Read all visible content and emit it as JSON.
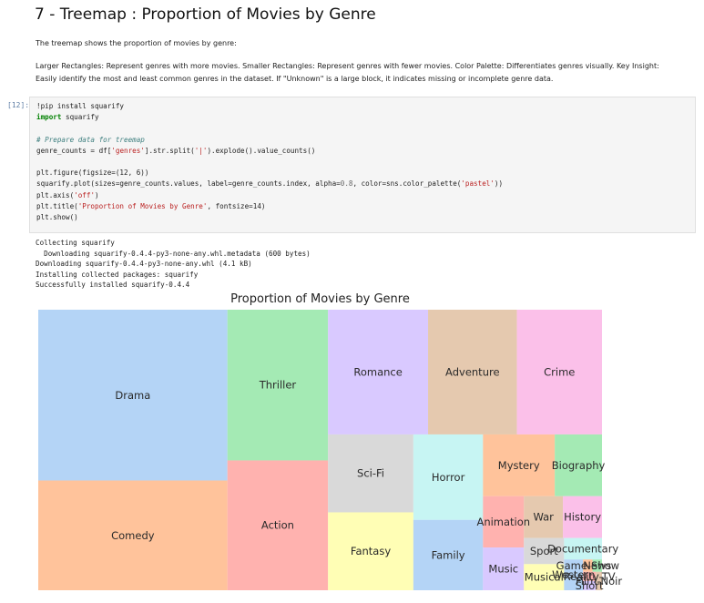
{
  "notebook": {
    "title": "7 - Treemap : Proportion of Movies by Genre",
    "intro": "The treemap shows the proportion of movies by genre:",
    "description_line1": "Larger Rectangles: Represent genres with more movies. Smaller Rectangles: Represent genres with fewer movies. Color Palette: Differentiates genres visually. Key Insight:",
    "description_line2": "Easily identify the most and least common genres in the dataset. If \"Unknown\" is a large block, it indicates missing or incomplete genre data.",
    "cell_prompt": "[12]:",
    "code": {
      "l1": "!pip install squarify",
      "l2_kw": "import",
      "l2_rest": " squarify",
      "l3_comment": "# Prepare data for treemap",
      "l4_a": "genre_counts = df[",
      "l4_str1": "'genres'",
      "l4_b": "].str.split(",
      "l4_str2": "'|'",
      "l4_c": ").explode().value_counts()",
      "l5": "plt.figure(figsize=(12, 6))",
      "l6_a": "squarify.plot(sizes=genre_counts.values, label=genre_counts.index, alpha=",
      "l6_num": "0.8",
      "l6_b": ", color=sns.color_palette(",
      "l6_str": "'pastel'",
      "l6_c": "))",
      "l7_a": "plt.axis(",
      "l7_str": "'off'",
      "l7_b": ")",
      "l8_a": "plt.title(",
      "l8_str": "'Proportion of Movies by Genre'",
      "l8_b": ", fontsize=14)",
      "l9": "plt.show()"
    },
    "output": {
      "o1": "Collecting squarify",
      "o2": "  Downloading squarify-0.4.4-py3-none-any.whl.metadata (600 bytes)",
      "o3": "Downloading squarify-0.4.4-py3-none-any.whl (4.1 kB)",
      "o4": "Installing collected packages: squarify",
      "o5": "Successfully installed squarify-0.4.4"
    }
  },
  "chart_data": {
    "type": "treemap",
    "title": "Proportion of Movies by Genre",
    "palette": [
      "#a1c9f4",
      "#ffb482",
      "#8de5a1",
      "#ff9f9b",
      "#d0bbff",
      "#debb9b",
      "#fab0e4",
      "#cfcfcf",
      "#fffea3",
      "#b9f2f0"
    ],
    "alpha": 0.8,
    "genres": [
      {
        "label": "Drama",
        "value": 277,
        "color": "#a1c9f4"
      },
      {
        "label": "Comedy",
        "value": 178,
        "color": "#ffb482"
      },
      {
        "label": "Thriller",
        "value": 130,
        "color": "#8de5a1"
      },
      {
        "label": "Action",
        "value": 112,
        "color": "#ff9f9b"
      },
      {
        "label": "Romance",
        "value": 107,
        "color": "#d0bbff"
      },
      {
        "label": "Adventure",
        "value": 95,
        "color": "#debb9b"
      },
      {
        "label": "Crime",
        "value": 91,
        "color": "#fab0e4"
      },
      {
        "label": "Sci-Fi",
        "value": 57,
        "color": "#cfcfcf"
      },
      {
        "label": "Fantasy",
        "value": 57,
        "color": "#fffea3"
      },
      {
        "label": "Horror",
        "value": 51,
        "color": "#b9f2f0"
      },
      {
        "label": "Family",
        "value": 42,
        "color": "#a1c9f4"
      },
      {
        "label": "Mystery",
        "value": 38,
        "color": "#ffb482"
      },
      {
        "label": "Biography",
        "value": 25,
        "color": "#8de5a1"
      },
      {
        "label": "Animation",
        "value": 18,
        "color": "#ff9f9b"
      },
      {
        "label": "Music",
        "value": 15,
        "color": "#d0bbff"
      },
      {
        "label": "War",
        "value": 14,
        "color": "#debb9b"
      },
      {
        "label": "History",
        "value": 14,
        "color": "#fab0e4"
      },
      {
        "label": "Sport",
        "value": 9,
        "color": "#cfcfcf"
      },
      {
        "label": "Musical",
        "value": 9,
        "color": "#fffea3"
      },
      {
        "label": "Documentary",
        "value": 7,
        "color": "#b9f2f0"
      },
      {
        "label": "Western",
        "value": 5,
        "color": "#a1c9f4"
      },
      {
        "label": "Game-Show",
        "value": 1,
        "color": "#ffb482"
      },
      {
        "label": "News",
        "value": 1,
        "color": "#8de5a1"
      },
      {
        "label": "Reality-TV",
        "value": 1,
        "color": "#ff9f9b"
      },
      {
        "label": "Short",
        "value": 1,
        "color": "#d0bbff"
      },
      {
        "label": "Film-Noir",
        "value": 1,
        "color": "#debb9b"
      }
    ]
  }
}
